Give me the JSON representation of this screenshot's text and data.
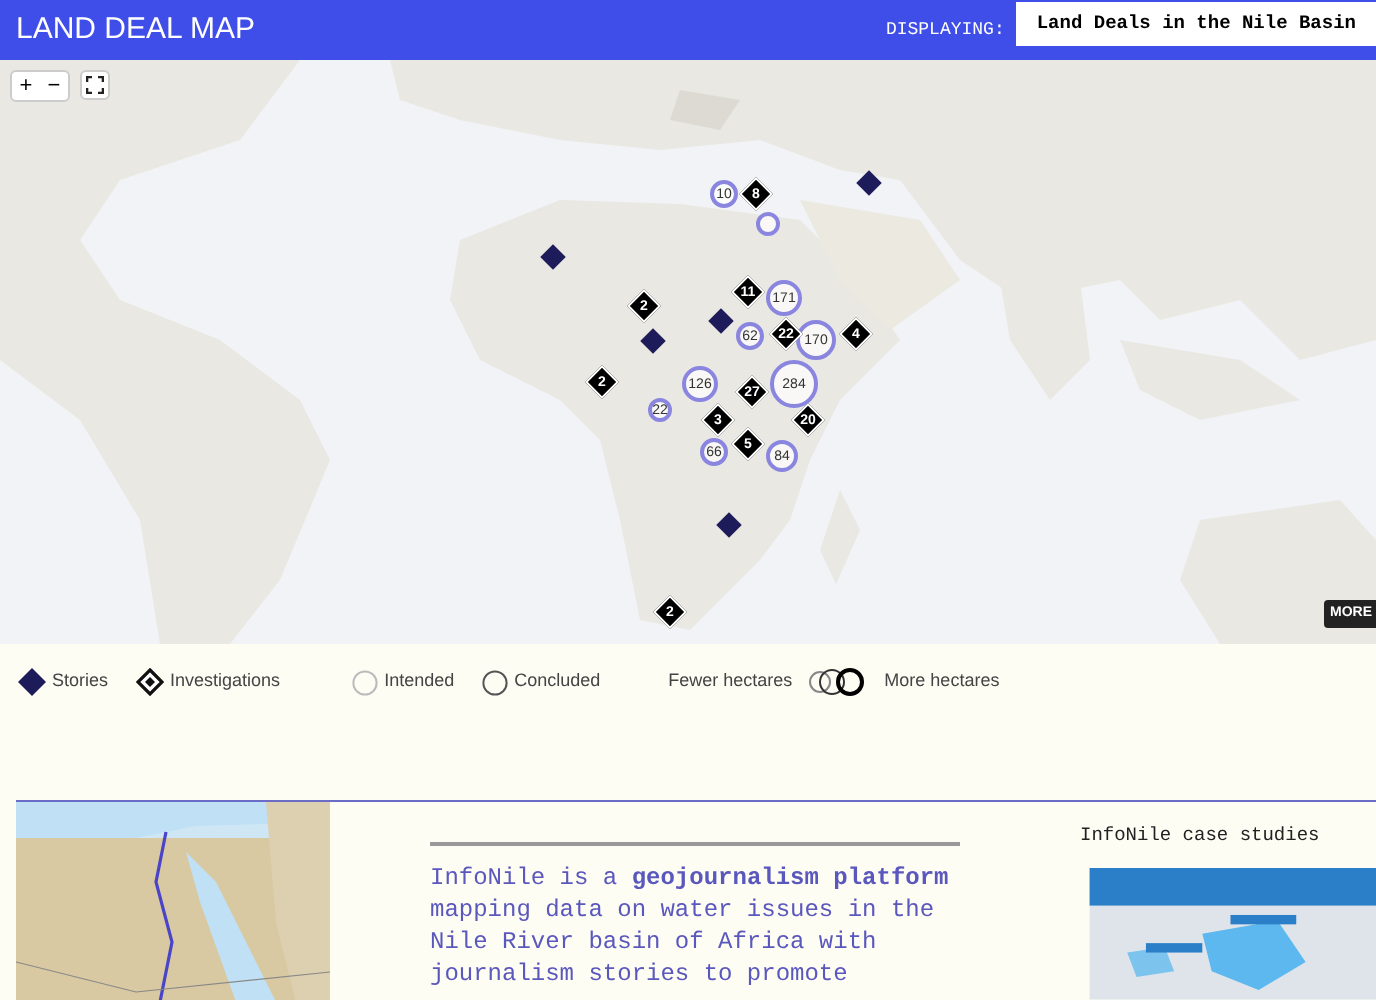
{
  "header": {
    "title": "LAND DEAL MAP",
    "displaying_label": "DISPLAYING:",
    "dataset": "Land Deals in the Nile Basin"
  },
  "map": {
    "zoom_in": "+",
    "zoom_out": "−",
    "more_button": "MORE",
    "markers": [
      {
        "kind": "investigation",
        "label": "8"
      },
      {
        "kind": "investigation",
        "label": "2"
      },
      {
        "kind": "investigation",
        "label": "2"
      },
      {
        "kind": "investigation",
        "label": "11"
      },
      {
        "kind": "investigation",
        "label": "22"
      },
      {
        "kind": "investigation",
        "label": "4"
      },
      {
        "kind": "investigation",
        "label": "3"
      },
      {
        "kind": "investigation",
        "label": "27"
      },
      {
        "kind": "investigation",
        "label": "5"
      },
      {
        "kind": "investigation",
        "label": "20"
      },
      {
        "kind": "investigation",
        "label": "2"
      },
      {
        "kind": "story"
      },
      {
        "kind": "story"
      },
      {
        "kind": "story"
      },
      {
        "kind": "story"
      },
      {
        "kind": "story"
      },
      {
        "kind": "deal",
        "label": "10"
      },
      {
        "kind": "deal"
      },
      {
        "kind": "deal",
        "label": "171"
      },
      {
        "kind": "deal",
        "label": "62"
      },
      {
        "kind": "deal",
        "label": "170"
      },
      {
        "kind": "deal",
        "label": "126"
      },
      {
        "kind": "deal",
        "label": "22"
      },
      {
        "kind": "deal",
        "label": "284"
      },
      {
        "kind": "deal",
        "label": "66"
      },
      {
        "kind": "deal",
        "label": "84"
      }
    ]
  },
  "legend": {
    "items": [
      {
        "kind": "story",
        "label": "Stories"
      },
      {
        "kind": "investigation",
        "label": "Investigations"
      },
      {
        "kind": "intended",
        "label": "Intended"
      },
      {
        "kind": "concluded",
        "label": "Concluded"
      }
    ],
    "scale_fewer": "Fewer hectares",
    "scale_more": "More hectares"
  },
  "about": {
    "text": "InfoNile is a **geojournalism platform** mapping data on water issues in the Nile River basin of Africa with journalism stories to promote"
  },
  "case_studies": {
    "title": "InfoNile case studies"
  }
}
